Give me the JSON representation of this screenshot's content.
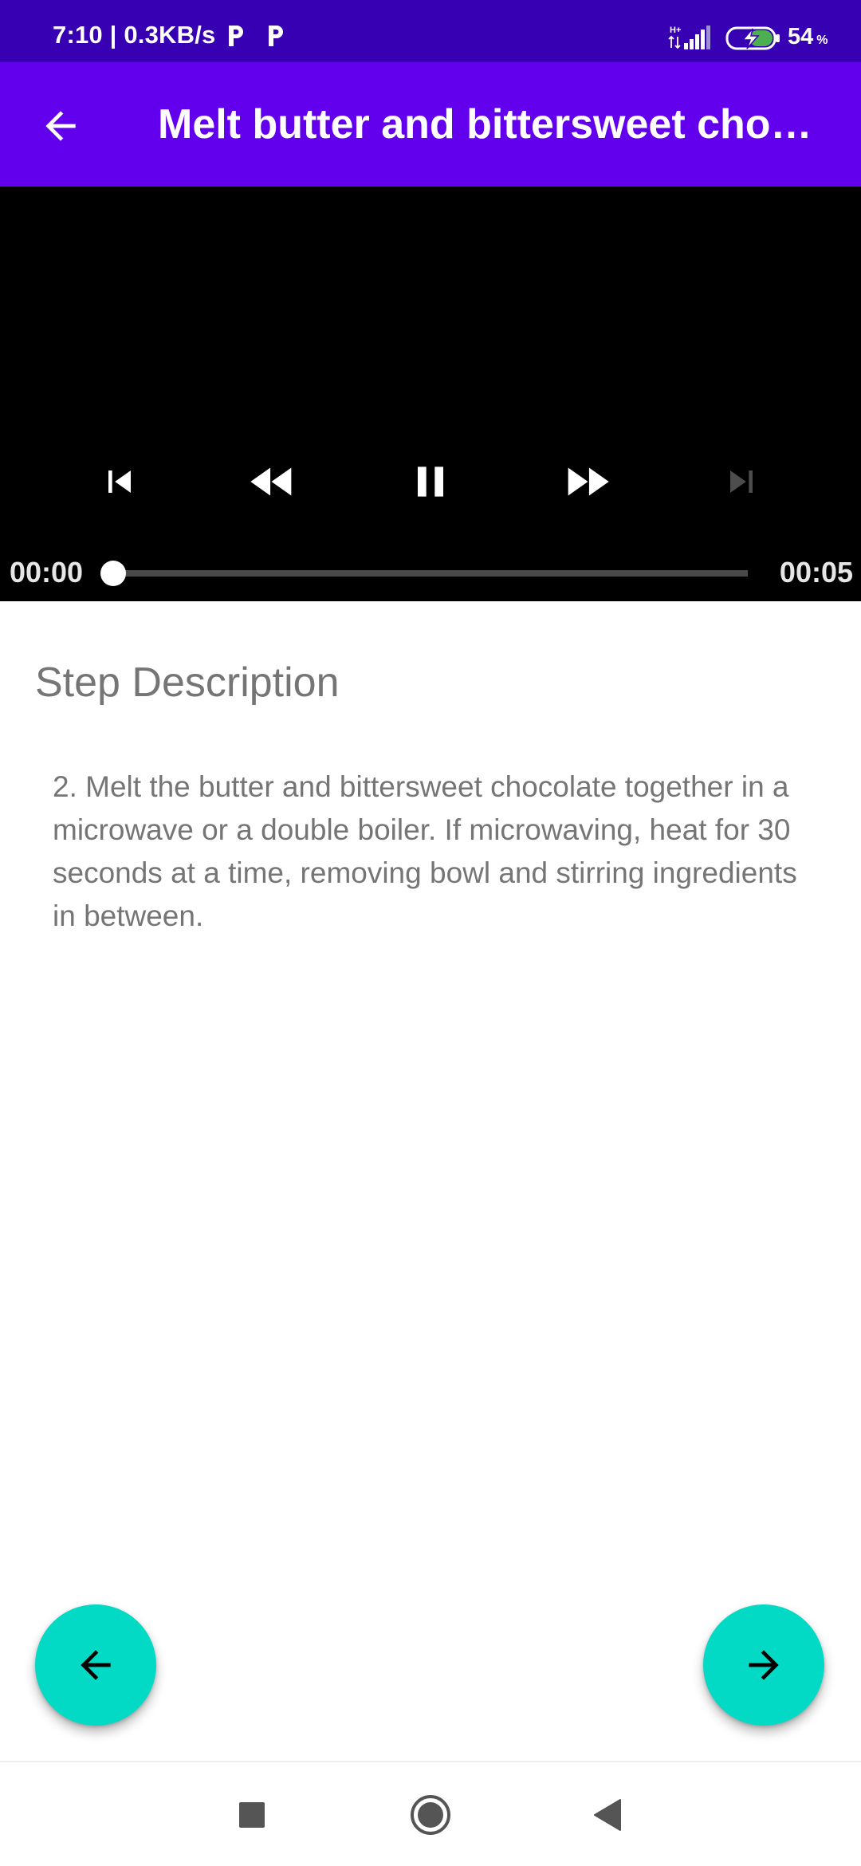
{
  "status_bar": {
    "time": "7:10 | 0.3KB/s",
    "network_type": "H+",
    "battery_percent": "54",
    "battery_symbol": "%",
    "icons": [
      "parking-icon",
      "parking-icon",
      "signal-icon",
      "battery-charging-icon"
    ]
  },
  "app_bar": {
    "back_icon": "arrow-back-icon",
    "title": "Melt butter and bittersweet chocolate."
  },
  "player": {
    "position": "00:00",
    "duration": "00:05",
    "progress": 0,
    "controls": [
      "skip-previous-icon",
      "rewind-icon",
      "pause-icon",
      "fast-forward-icon",
      "skip-next-icon"
    ],
    "skip_next_enabled": false
  },
  "step": {
    "heading": "Step Description",
    "description": "2. Melt the butter and bittersweet chocolate together in a microwave or a double boiler. If microwaving, heat for 30 seconds at a time, removing bowl and stirring ingredients in between."
  },
  "fabs": {
    "previous_icon": "arrow-back-icon",
    "next_icon": "arrow-forward-icon"
  },
  "nav_bar": {
    "buttons": [
      "recents-square-icon",
      "home-circle-icon",
      "back-triangle-icon"
    ]
  },
  "colors": {
    "status_bar": "#3700b3",
    "app_bar": "#6200ee",
    "fab": "#03dac5",
    "player_bg": "#000000",
    "text_secondary": "#757575",
    "battery_fill": "#4caf50"
  }
}
